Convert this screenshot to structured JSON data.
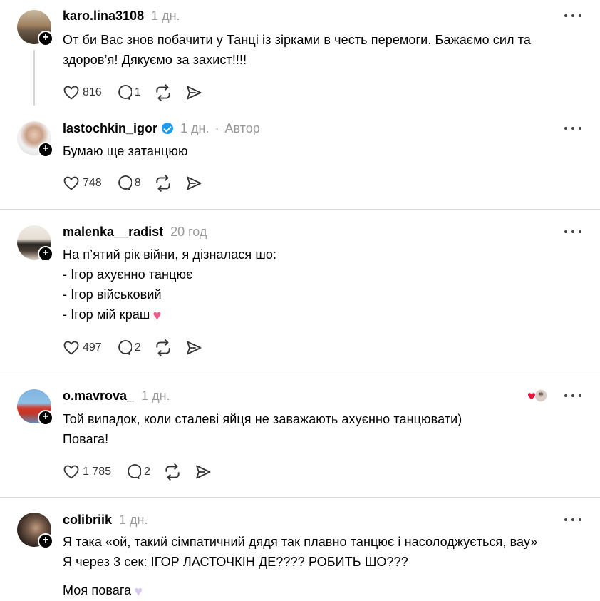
{
  "posts": [
    {
      "username": "karo.lina3108",
      "time": "1 дн.",
      "lines": [
        "От би Вас знов побачити у Танці із зірками в честь перемоги. Бажаємо сил та",
        "здоров’я! Дякуємо за захист!!!!"
      ],
      "likes": "816",
      "replies": "1"
    },
    {
      "username": "lastochkin_igor",
      "time": "1 дн.",
      "dot": "·",
      "author_label": "Автор",
      "lines": [
        "Бумаю ще затанцюю"
      ],
      "likes": "748",
      "replies": "8"
    },
    {
      "username": "malenka__radist",
      "time": "20 год",
      "lines": [
        "На п’ятий рік війни, я дізналася шо:",
        "- Ігор ахуєнно танцює",
        "- Ігор військовий",
        "- Ігор мій краш"
      ],
      "emoji": "♥",
      "likes": "497",
      "replies": "2"
    },
    {
      "username": "o.mavrova_",
      "time": "1 дн.",
      "lines": [
        "Той випадок, коли сталеві яйця не заважають ахуєнно танцювати)",
        "Повага!"
      ],
      "likes": "1 785",
      "replies": "2"
    },
    {
      "username": "colibriik",
      "time": "1 дн.",
      "lines": [
        "Я така «ой, такий сімпатичний дядя так плавно танцює і насолоджується, вау»",
        "Я через 3 сек: ІГОР ЛАСТОЧКІН ДЕ???? РОБИТЬ ШО???",
        "",
        "Моя повага"
      ],
      "emoji": "♥"
    }
  ],
  "colors": {
    "verified": "#1d9bf0",
    "heart_emoji": "#f05b8c",
    "light_heart": "#d9c8f0"
  },
  "icons": [
    "heart-icon",
    "comment-icon",
    "repost-icon",
    "share-icon",
    "more-icon",
    "follow-plus-icon",
    "verified-badge-icon"
  ]
}
